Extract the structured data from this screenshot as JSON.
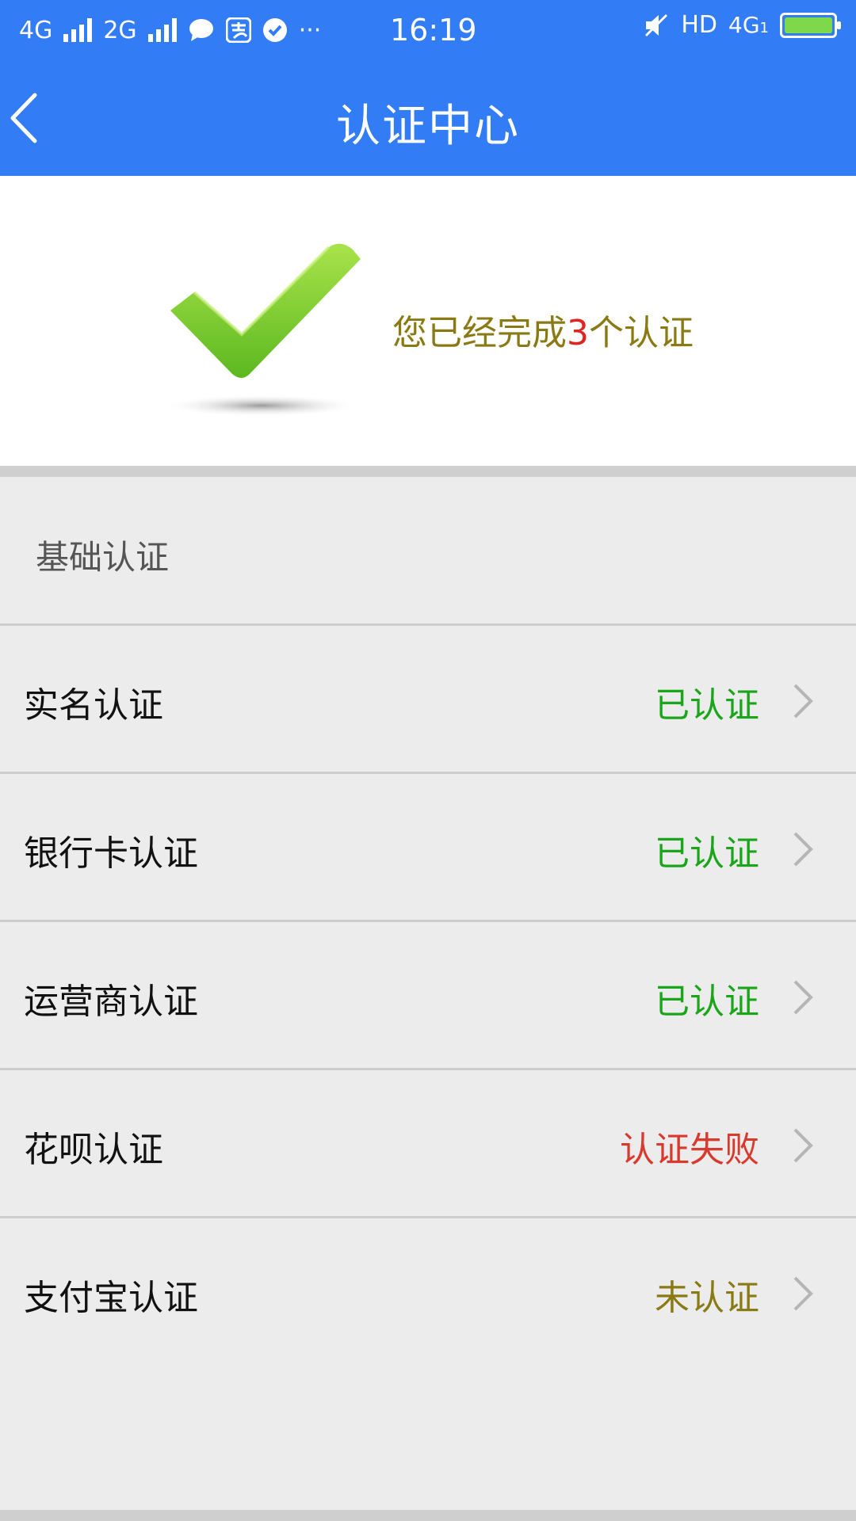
{
  "status_bar": {
    "network_1": "4G",
    "network_2": "2G",
    "time": "16:19",
    "hd": "HD",
    "network_right": "4G",
    "network_right_sub": "1",
    "dots": "···"
  },
  "header": {
    "title": "认证中心"
  },
  "summary": {
    "text_before": "您已经完成",
    "count": "3",
    "text_after": "个认证"
  },
  "section": {
    "title": "基础认证"
  },
  "items": [
    {
      "label": "实名认证",
      "status": "已认证",
      "status_color": "#1aa51a"
    },
    {
      "label": "银行卡认证",
      "status": "已认证",
      "status_color": "#1aa51a"
    },
    {
      "label": "运营商认证",
      "status": "已认证",
      "status_color": "#1aa51a"
    },
    {
      "label": "花呗认证",
      "status": "认证失败",
      "status_color": "#d93a2e"
    },
    {
      "label": "支付宝认证",
      "status": "未认证",
      "status_color": "#8a7a14"
    }
  ],
  "colors": {
    "primary": "#327cf5",
    "success": "#1aa51a",
    "error": "#d93a2e",
    "pending": "#8a7a14"
  }
}
